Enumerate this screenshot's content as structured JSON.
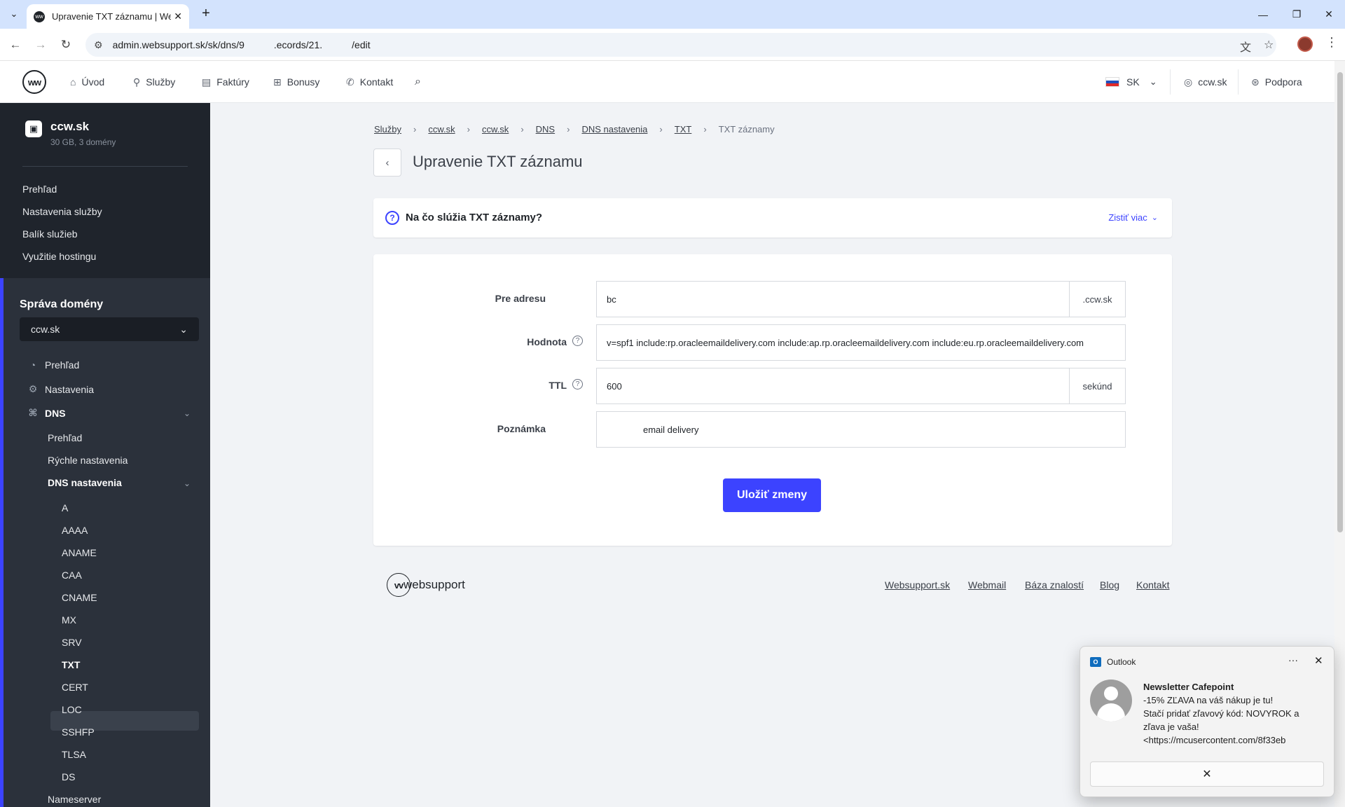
{
  "browser": {
    "tab_title": "Upravenie TXT záznamu | Webs",
    "tab_favicon": "ww",
    "url": "admin.websupport.sk/sk/dns/9      .ecords/21.      /edit"
  },
  "topnav": {
    "logo": "ww",
    "items": [
      {
        "label": "Úvod",
        "icon": "home-icon"
      },
      {
        "label": "Služby",
        "icon": "rocket-icon"
      },
      {
        "label": "Faktúry",
        "icon": "invoice-icon"
      },
      {
        "label": "Bonusy",
        "icon": "gift-icon"
      },
      {
        "label": "Kontakt",
        "icon": "phone-icon"
      }
    ],
    "language": "SK",
    "account": "ccw.sk",
    "support": "Podpora"
  },
  "sidebar": {
    "service_title": "ccw.sk",
    "service_subtitle": "30 GB, 3 domény",
    "service_links": [
      "Prehľad",
      "Nastavenia služby",
      "Balík služieb",
      "Využitie hostingu"
    ],
    "domain_heading": "Správa domény",
    "domain_select": "ccw.sk",
    "items": {
      "overview": "Prehľad",
      "settings": "Nastavenia",
      "dns": "DNS",
      "dns_overview": "Prehľad",
      "quick_settings": "Rýchle nastavenia",
      "dns_settings": "DNS nastavenia",
      "nameserver": "Nameserver"
    },
    "records": [
      "A",
      "AAAA",
      "ANAME",
      "CAA",
      "CNAME",
      "MX",
      "SRV",
      "TXT",
      "CERT",
      "LOC",
      "SSHFP",
      "TLSA",
      "DS"
    ],
    "active_record": "TXT"
  },
  "breadcrumb": {
    "links": [
      "Služby",
      "ccw.sk",
      "ccw.sk",
      "DNS",
      "DNS nastavenia",
      "TXT"
    ],
    "current": "TXT záznamy"
  },
  "page": {
    "title": "Upravenie TXT záznamu"
  },
  "info": {
    "title": "Na čo slúžia TXT záznamy?",
    "more": "Zistiť viac"
  },
  "form": {
    "address_label": "Pre adresu",
    "address_value": "bc",
    "address_suffix": ".ccw.sk",
    "value_label": "Hodnota",
    "value_value": "v=spf1 include:rp.oracleemaildelivery.com include:ap.rp.oracleemaildelivery.com include:eu.rp.oracleemaildelivery.com",
    "ttl_label": "TTL",
    "ttl_value": "600",
    "ttl_suffix": "sekúnd",
    "note_label": "Poznámka",
    "note_value": "        email delivery",
    "save_label": "Uložiť zmeny"
  },
  "footer": {
    "logo_text": "websupport",
    "links": [
      "Websupport.sk",
      "Webmail",
      "Báza znalostí",
      "Blog",
      "Kontakt"
    ]
  },
  "notification": {
    "app": "Outlook",
    "title": "Newsletter Cafepoint",
    "lines": [
      "-15% ZĽAVA na váš nákup je tu!",
      "Stačí pridať zľavový kód: NOVYROK a",
      "zľava je vaša!",
      " <https://mcusercontent.com/8f33eb"
    ]
  }
}
